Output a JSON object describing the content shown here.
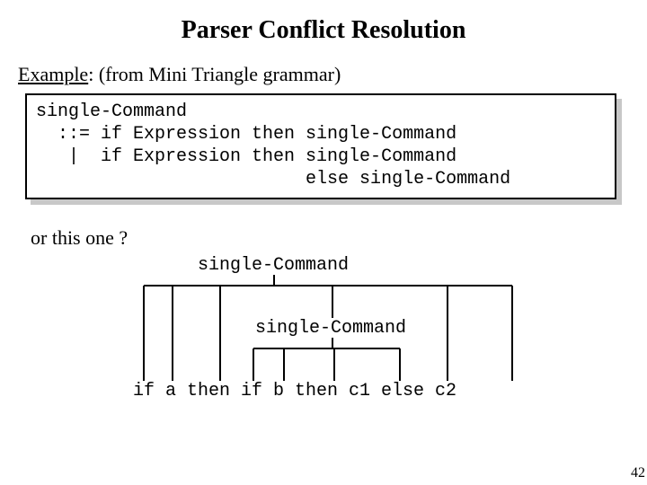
{
  "title": "Parser Conflict Resolution",
  "example_label": "Example",
  "example_rest": ": (from Mini Triangle grammar)",
  "grammar": "single-Command\n  ::= if Expression then single-Command\n   |  if Expression then single-Command\n                         else single-Command",
  "or_line": "or this one ?",
  "tree_top": "single-Command",
  "tree_mid": "single-Command",
  "sentence": "if a then if b then c1 else c2",
  "page_number": "42"
}
